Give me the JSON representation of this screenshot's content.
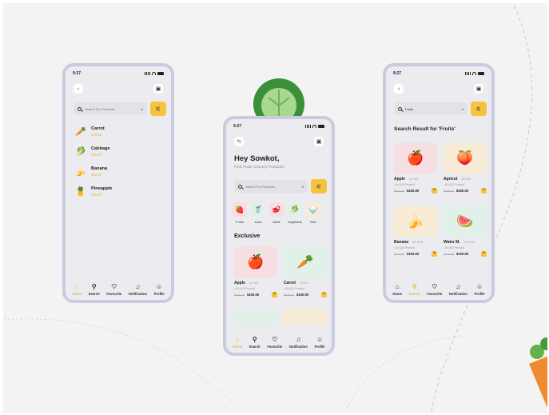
{
  "phone1": {
    "time": "9:27",
    "search_placeholder": "Search For Products...",
    "items": [
      {
        "name": "Carrot",
        "price": "$15.00",
        "icon": "carrot-icon",
        "glyph": "🥕"
      },
      {
        "name": "Cabbage",
        "price": "$15.00",
        "icon": "cabbage-icon",
        "glyph": "🥬"
      },
      {
        "name": "Banana",
        "price": "$15.00",
        "icon": "banana-icon",
        "glyph": "🍌"
      },
      {
        "name": "Pineapple",
        "price": "$15.00",
        "icon": "pineapple-icon",
        "glyph": "🍍"
      }
    ],
    "tabs": [
      {
        "label": "Home",
        "icon": "home-icon",
        "glyph": "⌂",
        "active": true
      },
      {
        "label": "Search",
        "icon": "search-icon",
        "glyph": "⚲",
        "active": false
      },
      {
        "label": "Favourite",
        "icon": "heart-icon",
        "glyph": "♡",
        "active": false
      },
      {
        "label": "Notification",
        "icon": "bell-icon",
        "glyph": "🔔",
        "active": false
      },
      {
        "label": "Profile",
        "icon": "profile-icon",
        "glyph": "☺",
        "active": false
      }
    ]
  },
  "phone2": {
    "time": "9:27",
    "greeting": "Hey Sowkot,",
    "subtitle": "Find Fresh Grocery Products!",
    "search_placeholder": "Search For Products...",
    "categories": [
      {
        "label": "Fruits",
        "glyph": "🍓",
        "bg": "#f6dfe0"
      },
      {
        "label": "Juice",
        "glyph": "🥤",
        "bg": "#dff1e8"
      },
      {
        "label": "Meat",
        "glyph": "🥩",
        "bg": "#f6dfe0"
      },
      {
        "label": "Vegetable",
        "glyph": "🥬",
        "bg": "#dff1e8"
      },
      {
        "label": "Rice",
        "glyph": "🍚",
        "bg": "#f9ecd6"
      }
    ],
    "section": "Exclusive",
    "products": [
      {
        "name": "Apple",
        "unit": "1X KG",
        "avail": "• AV:(100 Product)",
        "old": "$120.00",
        "new": "$100.00",
        "glyph": "🍎",
        "bg": "#f6dfe0"
      },
      {
        "name": "Carrot",
        "unit": "1X KG",
        "avail": "• AV:(100 Product)",
        "old": "$120.00",
        "new": "$100.00",
        "glyph": "🥕",
        "bg": "#dff1e8"
      }
    ],
    "tabs": [
      {
        "label": "Home",
        "glyph": "⌂",
        "active": true
      },
      {
        "label": "Search",
        "glyph": "⚲",
        "active": false
      },
      {
        "label": "Favourite",
        "glyph": "♡",
        "active": false
      },
      {
        "label": "Notification",
        "glyph": "🔔",
        "active": false
      },
      {
        "label": "Profile",
        "glyph": "☺",
        "active": false
      }
    ]
  },
  "phone3": {
    "time": "9:27",
    "search_value": "Fruits",
    "result_title": "Search Result for 'Fruits'",
    "products": [
      {
        "name": "Apple",
        "unit": "1X KG",
        "avail": "• AV:(100 Product)",
        "old": "$120.00",
        "new": "$100.00",
        "glyph": "🍎",
        "bg": "#f6dfe0"
      },
      {
        "name": "Apricot",
        "unit": "2X KG",
        "avail": "• AV:(100 Product)",
        "old": "$120.00",
        "new": "$100.00",
        "glyph": "🍑",
        "bg": "#f9ecd6"
      },
      {
        "name": "Banana",
        "unit": "5X PCS",
        "avail": "• AV:(100 Product)",
        "old": "$120.00",
        "new": "$100.00",
        "glyph": "🍌",
        "bg": "#f9ecd6"
      },
      {
        "name": "Water M.",
        "unit": "2X PCS",
        "avail": "• AV:(100 Product)",
        "old": "$120.00",
        "new": "$100.00",
        "glyph": "🍉",
        "bg": "#dff1e8"
      }
    ],
    "tabs": [
      {
        "label": "Home",
        "glyph": "⌂",
        "active": false
      },
      {
        "label": "Search",
        "glyph": "⚲",
        "active": true
      },
      {
        "label": "Favourite",
        "glyph": "♡",
        "active": false
      },
      {
        "label": "Notification",
        "glyph": "🔔",
        "active": false
      },
      {
        "label": "Profile",
        "glyph": "☺",
        "active": false
      }
    ]
  },
  "colors": {
    "accent": "#f5c33d",
    "phone_border": "#cbcbdf",
    "active_tab": "#e5b94a"
  }
}
